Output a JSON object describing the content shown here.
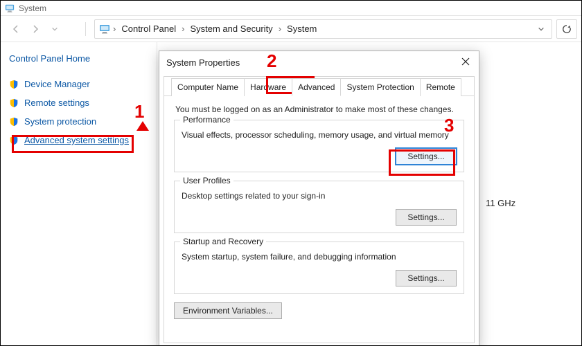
{
  "window": {
    "title": "System"
  },
  "breadcrumb": {
    "items": [
      "Control Panel",
      "System and Security",
      "System"
    ]
  },
  "sidebar": {
    "home": "Control Panel Home",
    "links": [
      {
        "label": "Device Manager"
      },
      {
        "label": "Remote settings"
      },
      {
        "label": "System protection"
      },
      {
        "label": "Advanced system settings"
      }
    ]
  },
  "content_peek": {
    "clock_speed": "11 GHz"
  },
  "dialog": {
    "title": "System Properties",
    "close_glyph": "✕",
    "tabs": [
      "Computer Name",
      "Hardware",
      "Advanced",
      "System Protection",
      "Remote"
    ],
    "active_tab_index": 2,
    "admin_note": "You must be logged on as an Administrator to make most of these changes.",
    "groups": {
      "performance": {
        "legend": "Performance",
        "desc": "Visual effects, processor scheduling, memory usage, and virtual memory",
        "button": "Settings..."
      },
      "user_profiles": {
        "legend": "User Profiles",
        "desc": "Desktop settings related to your sign-in",
        "button": "Settings..."
      },
      "startup": {
        "legend": "Startup and Recovery",
        "desc": "System startup, system failure, and debugging information",
        "button": "Settings..."
      }
    },
    "env_button": "Environment Variables..."
  },
  "annotations": {
    "n1": "1",
    "n2": "2",
    "n3": "3"
  }
}
